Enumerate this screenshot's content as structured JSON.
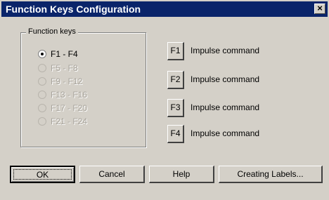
{
  "window": {
    "title": "Function Keys Configuration",
    "close_glyph": "×"
  },
  "group": {
    "legend": "Function keys",
    "options": [
      {
        "label": "F1 - F4",
        "selected": true,
        "enabled": true
      },
      {
        "label": "F5 - F8",
        "selected": false,
        "enabled": false
      },
      {
        "label": "F9 - F12",
        "selected": false,
        "enabled": false
      },
      {
        "label": "F13 - F16",
        "selected": false,
        "enabled": false
      },
      {
        "label": "F17 - F20",
        "selected": false,
        "enabled": false
      },
      {
        "label": "F21 - F24",
        "selected": false,
        "enabled": false
      }
    ]
  },
  "keys": [
    {
      "key": "F1",
      "label": "Impulse command"
    },
    {
      "key": "F2",
      "label": "Impulse command"
    },
    {
      "key": "F3",
      "label": "Impulse command"
    },
    {
      "key": "F4",
      "label": "Impulse command"
    }
  ],
  "buttons": {
    "ok": "OK",
    "cancel": "Cancel",
    "help": "Help",
    "labels": "Creating Labels..."
  }
}
